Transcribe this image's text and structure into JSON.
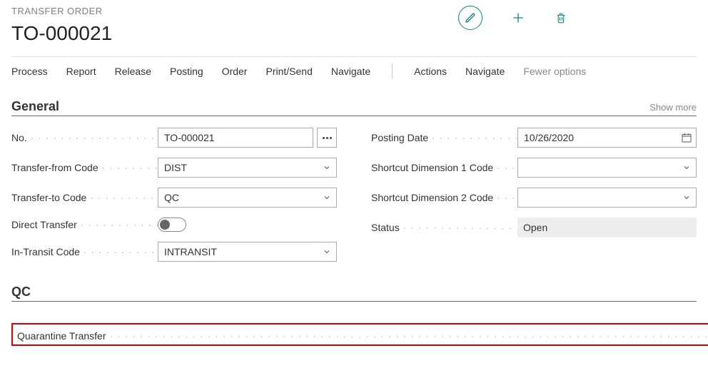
{
  "entity_label": "TRANSFER ORDER",
  "record_id": "TO-000021",
  "tabs": {
    "process": "Process",
    "report": "Report",
    "release": "Release",
    "posting": "Posting",
    "order": "Order",
    "print_send": "Print/Send",
    "navigate1": "Navigate",
    "actions": "Actions",
    "navigate2": "Navigate",
    "fewer": "Fewer options"
  },
  "sections": {
    "general": {
      "title": "General",
      "show_more": "Show more",
      "fields": {
        "no": {
          "label": "No.",
          "value": "TO-000021"
        },
        "transfer_from": {
          "label": "Transfer-from Code",
          "value": "DIST"
        },
        "transfer_to": {
          "label": "Transfer-to Code",
          "value": "QC"
        },
        "direct_transfer": {
          "label": "Direct Transfer",
          "value": false
        },
        "in_transit": {
          "label": "In-Transit Code",
          "value": "INTRANSIT"
        },
        "posting_date": {
          "label": "Posting Date",
          "value": "10/26/2020"
        },
        "dim1": {
          "label": "Shortcut Dimension 1 Code",
          "value": ""
        },
        "dim2": {
          "label": "Shortcut Dimension 2 Code",
          "value": ""
        },
        "status": {
          "label": "Status",
          "value": "Open"
        }
      }
    },
    "qc": {
      "title": "QC",
      "fields": {
        "quarantine": {
          "label": "Quarantine Transfer",
          "value": true
        }
      }
    }
  }
}
